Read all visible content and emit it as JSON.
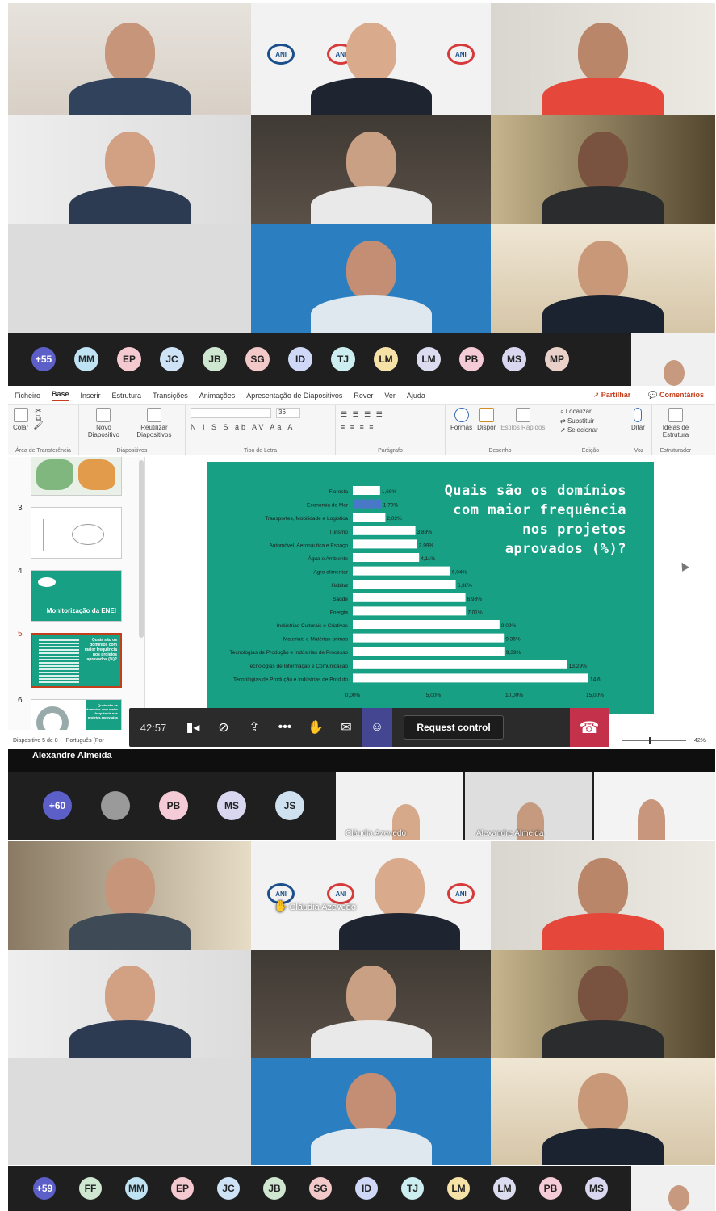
{
  "meeting": {
    "top_avatars": [
      {
        "initials": "+55",
        "color": "#5b5fc7"
      },
      {
        "initials": "MM",
        "color": "#bfe3f3"
      },
      {
        "initials": "EP",
        "color": "#f4c9cf"
      },
      {
        "initials": "JC",
        "color": "#cfe3f7"
      },
      {
        "initials": "JB",
        "color": "#cfe7d1"
      },
      {
        "initials": "SG",
        "color": "#f3c8c8"
      },
      {
        "initials": "ID",
        "color": "#cfd8f7"
      },
      {
        "initials": "TJ",
        "color": "#cdeef0"
      },
      {
        "initials": "LM",
        "color": "#f6e2a7"
      },
      {
        "initials": "LM",
        "color": "#dcdcf0"
      },
      {
        "initials": "PB",
        "color": "#f5cbd7"
      },
      {
        "initials": "MS",
        "color": "#d9d6f0"
      },
      {
        "initials": "MP",
        "color": "#e9d0c9"
      }
    ],
    "mid_avatars": [
      {
        "initials": "+60",
        "color": "#5b5fc7"
      },
      {
        "initials": "",
        "color": "#9a9a9a"
      },
      {
        "initials": "PB",
        "color": "#f5cbd7"
      },
      {
        "initials": "MS",
        "color": "#d9d6f0"
      },
      {
        "initials": "JS",
        "color": "#cfe0ef"
      }
    ],
    "bottom_avatars": [
      {
        "initials": "+59",
        "color": "#5b5fc7"
      },
      {
        "initials": "FF",
        "color": "#cfe7d1"
      },
      {
        "initials": "MM",
        "color": "#bfe3f3"
      },
      {
        "initials": "EP",
        "color": "#f4c9cf"
      },
      {
        "initials": "JC",
        "color": "#cfe3f7"
      },
      {
        "initials": "JB",
        "color": "#cfe7d1"
      },
      {
        "initials": "SG",
        "color": "#f3c8c8"
      },
      {
        "initials": "ID",
        "color": "#cfd8f7"
      },
      {
        "initials": "TJ",
        "color": "#cdeef0"
      },
      {
        "initials": "LM",
        "color": "#f6e2a7"
      },
      {
        "initials": "LM",
        "color": "#dcdcf0"
      },
      {
        "initials": "PB",
        "color": "#f5cbd7"
      },
      {
        "initials": "MS",
        "color": "#d9d6f0"
      }
    ],
    "thumb_captions": {
      "claudia": "Cláudia Azevedo",
      "alexandre": "Alexandre Almeida"
    },
    "raised_hand_name": "Cláudia Azevedo",
    "presenter_name": "Alexandre Almeida",
    "timer": "42:57",
    "request_control": "Request control"
  },
  "ppt": {
    "tabs": [
      "Ficheiro",
      "Base",
      "Inserir",
      "Estrutura",
      "Transições",
      "Animações",
      "Apresentação de Diapositivos",
      "Rever",
      "Ver",
      "Ajuda"
    ],
    "share": "Partilhar",
    "comments": "Comentários",
    "groups": {
      "clipboard": "Área de Transferência",
      "slides": "Diapositivos",
      "font": "Tipo de Letra",
      "paragraph": "Parágrafo",
      "drawing": "Desenho",
      "editing": "Edição",
      "voice": "Voz",
      "designer": "Estruturador"
    },
    "buttons": {
      "paste": "Colar",
      "new_slide": "Novo Diapositivo",
      "reuse": "Reutilizar Diapositivos",
      "shapes": "Formas",
      "arrange": "Dispor",
      "quick_styles": "Estilos Rápidos",
      "find": "Localizar",
      "replace": "Substituir",
      "select": "Selecionar",
      "dictate": "Ditar",
      "design_ideas": "Ideias de Estrutura"
    },
    "font_size": "36",
    "slide_status": "Diapositivo 5 de 8",
    "language": "Português (Por",
    "zoom": "42%",
    "thumb_slide4_title": "Monitorização da ENEI",
    "thumb_slide5_title": "Quais são os domínios com maior frequência nos projetos aprovados (%)?",
    "thumb_slide6_title": "Quais são os domínios com maior frequência nos projetos aprovados"
  },
  "slide": {
    "title": "Quais são os domínios com maior frequência nos projetos aprovados (%)?"
  },
  "chart_data": {
    "type": "bar",
    "orientation": "horizontal",
    "title": "Quais são os domínios com maior frequência nos projetos aprovados (%)?",
    "categories": [
      "Floresta",
      "Economia do Mar",
      "Transportes, Mobilidade e Logística",
      "Turismo",
      "Automóvel, Aeronáutica e Espaço",
      "Água e Ambiente",
      "Agro-alimentar",
      "Habitat",
      "Saúde",
      "Energia",
      "Indústrias Culturais e Criativas",
      "Materiais e Matérias-primas",
      "Tecnologias de Produção e Indústrias de Processo",
      "Tecnologias de Informação e Comunicação",
      "Tecnologias de Produção e Indústrias de Produto"
    ],
    "values": [
      1.69,
      1.79,
      2.02,
      3.88,
      3.99,
      4.11,
      6.04,
      6.38,
      6.98,
      7.01,
      9.09,
      9.36,
      9.39,
      13.29,
      14.6
    ],
    "data_labels": [
      "1,69%",
      "1,79%",
      "2,02%",
      "3,88%",
      "3,99%",
      "4,11%",
      "6,04%",
      "6,38%",
      "6,98%",
      "7,01%",
      "9,09%",
      "9,36%",
      "9,39%",
      "13,29%",
      "14,6"
    ],
    "highlight_index": 1,
    "xlim": [
      0,
      15
    ],
    "x_ticks": [
      "0,00%",
      "5,00%",
      "10,00%",
      "15,00%"
    ],
    "colors": {
      "bar": "#ffffff",
      "highlight": "#4a78c8",
      "background": "#17a084",
      "text": "#1d1d1d"
    },
    "grid": false
  }
}
